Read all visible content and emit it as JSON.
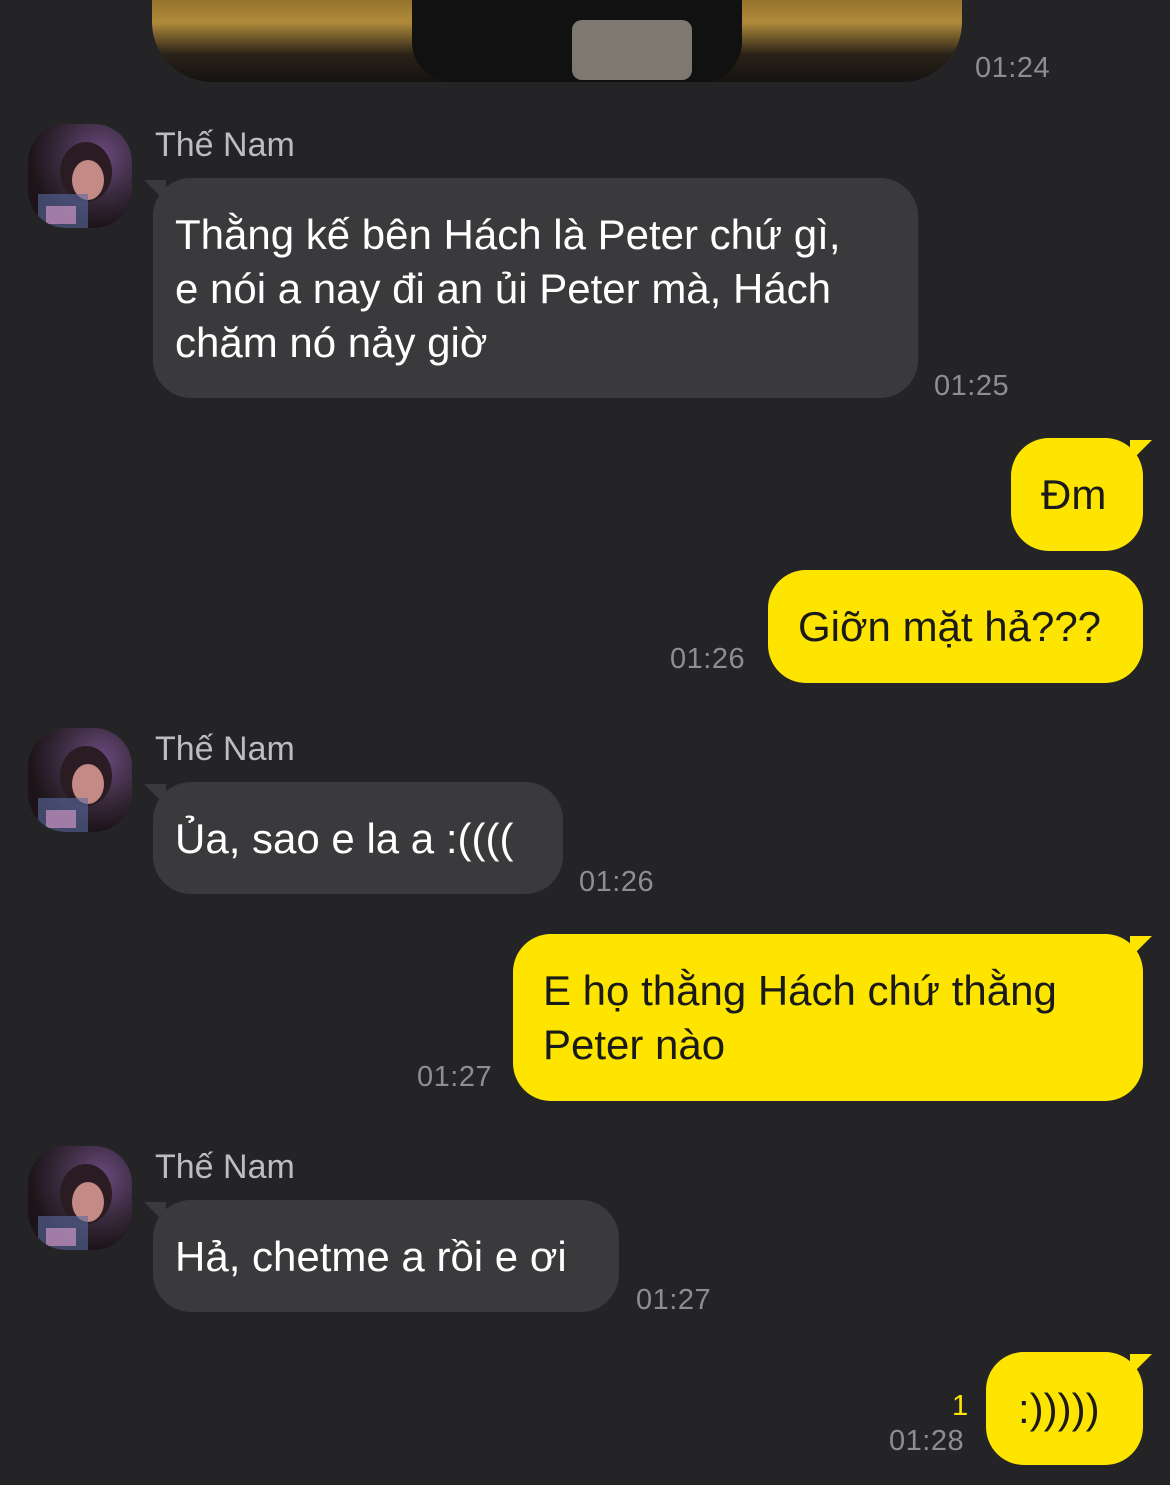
{
  "colors": {
    "background": "#242426",
    "incoming_bubble": "#3a3a3d",
    "outgoing_bubble": "#fee500",
    "timestamp": "#8e8e91",
    "unread": "#fee500"
  },
  "messages": {
    "photo": {
      "time": "01:24"
    },
    "m1": {
      "sender": "Thế Nam",
      "lines": [
        "Thằng kế bên Hách là Peter chứ gì,",
        "e nói a nay đi an ủi Peter mà, Hách",
        "chăm nó nảy giờ"
      ],
      "time": "01:25"
    },
    "m2": {
      "text": "Đm"
    },
    "m3": {
      "text": "Giỡn mặt hả???",
      "time": "01:26"
    },
    "m4": {
      "sender": "Thế Nam",
      "text": "Ủa, sao e la a :((((",
      "time": "01:26"
    },
    "m5": {
      "lines": [
        "E họ thằng Hách chứ thằng",
        "Peter nào"
      ],
      "time": "01:27"
    },
    "m6": {
      "sender": "Thế Nam",
      "text": "Hả, chetme a rồi e ơi",
      "time": "01:27"
    },
    "m7": {
      "text": ":)))))",
      "time": "01:28",
      "unread_count": "1"
    }
  }
}
